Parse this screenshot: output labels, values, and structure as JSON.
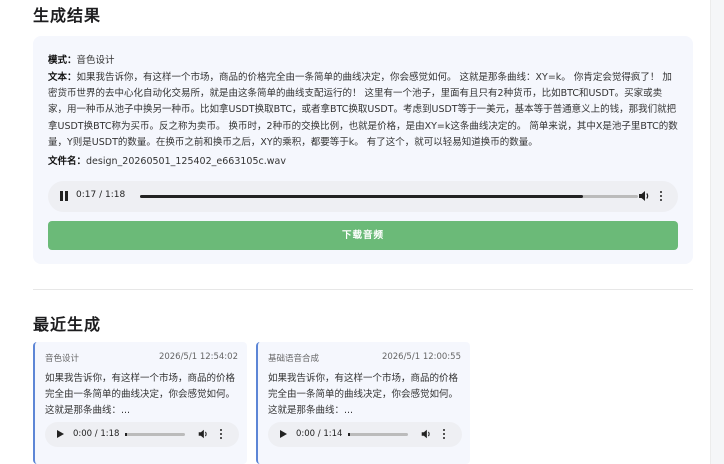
{
  "result": {
    "heading": "生成结果",
    "mode_label": "模式：",
    "mode_value": "音色设计",
    "text_label": "文本：",
    "text_value": "如果我告诉你，有这样一个市场，商品的价格完全由一条简单的曲线决定，你会感觉如何。 这就是那条曲线：XY=k。 你肯定会觉得疯了！ 加密货币世界的去中心化自动化交易所，就是由这条简单的曲线支配运行的！ 这里有一个池子，里面有且只有2种货币，比如BTC和USDT。买家或卖家，用一种币从池子中换另一种币。比如拿USDT换取BTC，或者拿BTC换取USDT。考虑到USDT等于一美元，基本等于普通意义上的钱，那我们就把拿USDT换BTC称为买币。反之称为卖币。 换币时，2种币的交换比例，也就是价格，是由XY=k这条曲线决定的。 简单来说，其中X是池子里BTC的数量，Y则是USDT的数量。在换币之前和换币之后，XY的乘积，都要等于k。 有了这个，就可以轻易知道换币的数量。",
    "filename_label": "文件名：",
    "filename_value": "design_20260501_125402_e663105c.wav",
    "player": {
      "time": "0:17 / 1:18",
      "progress": 0.89,
      "state": "playing"
    },
    "download_label": "下载音频"
  },
  "recent": {
    "heading": "最近生成",
    "items": [
      {
        "type": "音色设计",
        "timestamp": "2026/5/1 12:54:02",
        "preview": "如果我告诉你，有这样一个市场，商品的价格完全由一条简单的曲线决定，你会感觉如何。 这就是那条曲线：...",
        "player": {
          "time": "0:00 / 1:18",
          "progress": 0.0
        }
      },
      {
        "type": "基础语音合成",
        "timestamp": "2026/5/1 12:00:55",
        "preview": "如果我告诉你，有这样一个市场，商品的价格完全由一条简单的曲线决定，你会感觉如何。 这就是那条曲线：...",
        "player": {
          "time": "0:00 / 1:14",
          "progress": 0.0
        }
      }
    ]
  },
  "colors": {
    "download_button": "#6bba78",
    "card_accent": "#5d86d6",
    "card_bg": "#f5f7fd"
  }
}
